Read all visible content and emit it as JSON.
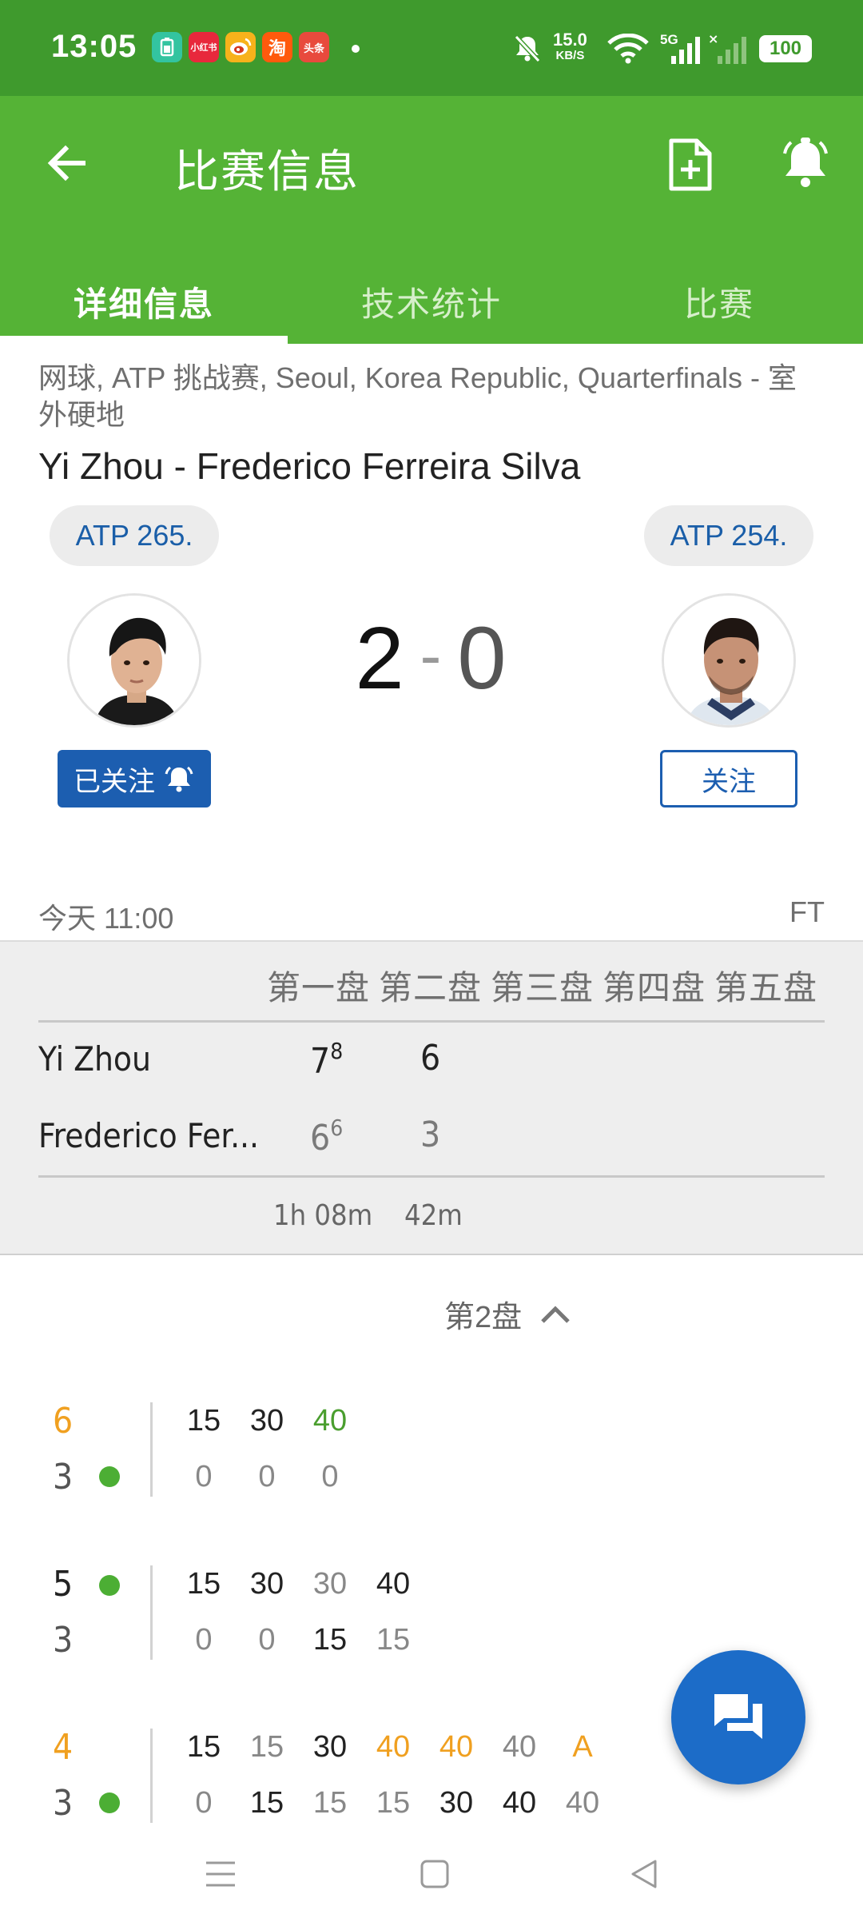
{
  "status_bar": {
    "time": "13:05",
    "app_icons": [
      {
        "name": "battery-app-icon",
        "text": "",
        "color": "#33c4a0"
      },
      {
        "name": "xiaohongshu-icon",
        "text": "小红书",
        "color": "#e8283c"
      },
      {
        "name": "weibo-icon",
        "text": "",
        "color": "#f7b21b"
      },
      {
        "name": "taobao-icon",
        "text": "淘",
        "color": "#ff5a0d"
      },
      {
        "name": "toutiao-icon",
        "text": "头条",
        "color": "#e84a3d"
      }
    ],
    "net_speed_value": "15.0",
    "net_speed_unit": "KB/S",
    "network": "5G",
    "battery": "100"
  },
  "app_bar": {
    "title": "比赛信息",
    "tabs": [
      {
        "label": "详细信息",
        "active": true
      },
      {
        "label": "技术统计",
        "active": false
      },
      {
        "label": "比赛",
        "active": false
      }
    ]
  },
  "match": {
    "breadcrumb": "网球, ATP 挑战赛, Seoul, Korea Republic, Quarterfinals - 室外硬地",
    "title": "Yi Zhou - Frederico Ferreira Silva",
    "player1": {
      "rank": "ATP 265.",
      "follow_label": "已关注"
    },
    "player2": {
      "rank": "ATP 254.",
      "follow_label": "关注"
    },
    "score_home": "2",
    "score_sep": "-",
    "score_away": "0",
    "time_label": "今天 11:00",
    "status": "FT"
  },
  "sets_table": {
    "headers": [
      "第一盘",
      "第二盘",
      "第三盘",
      "第四盘",
      "第五盘"
    ],
    "rows": [
      {
        "name": "Yi Zhou",
        "sets": [
          {
            "games": "7",
            "tb": "8"
          },
          {
            "games": "6",
            "tb": ""
          }
        ]
      },
      {
        "name": "Frederico Fer...",
        "sets": [
          {
            "games": "6",
            "tb": "6"
          },
          {
            "games": "3",
            "tb": ""
          }
        ]
      }
    ],
    "durations": [
      "1h 08m",
      "42m"
    ]
  },
  "set_selector": {
    "label": "第2盘"
  },
  "games": [
    {
      "top": {
        "score": "6",
        "serve": false
      },
      "bottom": {
        "score": "3",
        "serve": true
      },
      "top_points": [
        "15",
        "30",
        "40"
      ],
      "bottom_points": [
        "0",
        "0",
        "0"
      ]
    },
    {
      "top": {
        "score": "5",
        "serve": true
      },
      "bottom": {
        "score": "3",
        "serve": false
      },
      "top_points": [
        "15",
        "30",
        "30",
        "40"
      ],
      "bottom_points": [
        "0",
        "0",
        "15",
        "15"
      ]
    },
    {
      "top": {
        "score": "4",
        "serve": false
      },
      "bottom": {
        "score": "3",
        "serve": true
      },
      "top_points": [
        "15",
        "15",
        "30",
        "40",
        "40",
        "40",
        "A"
      ],
      "bottom_points": [
        "0",
        "15",
        "15",
        "15",
        "30",
        "40",
        "40"
      ]
    }
  ],
  "colors": {
    "status_bar": "#3f9a2d",
    "app_bar": "#55b336",
    "accent_blue": "#1c5eb0",
    "serve_dot": "#4cae34",
    "highlight_orange": "#f0a020"
  }
}
